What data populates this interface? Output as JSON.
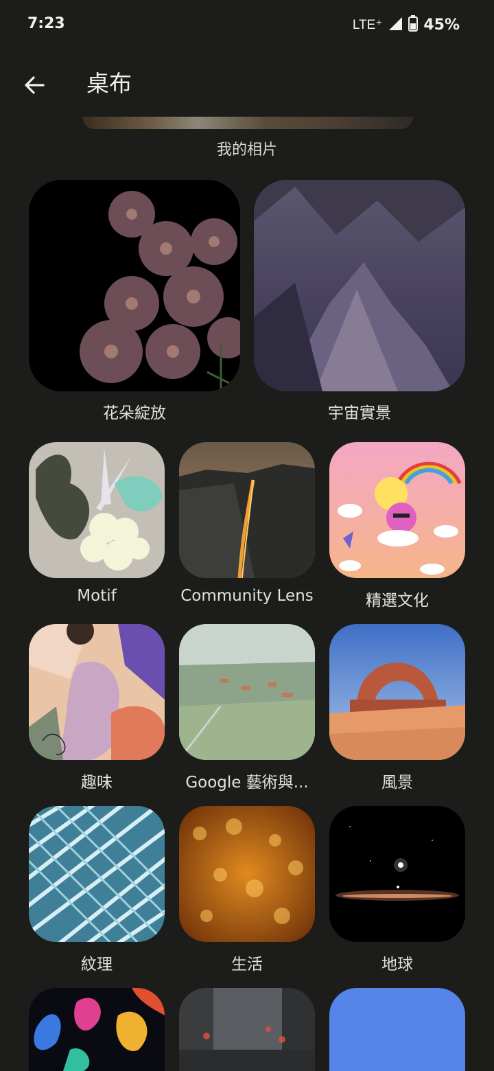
{
  "status": {
    "time": "7:23",
    "network": "LTE⁺",
    "battery": "45%"
  },
  "appbar": {
    "title": "桌布"
  },
  "my_photos": {
    "label": "我的相片"
  },
  "categories": [
    {
      "label": "花朵綻放"
    },
    {
      "label": "宇宙實景"
    },
    {
      "label": "Motif"
    },
    {
      "label": "Community Lens"
    },
    {
      "label": "精選文化"
    },
    {
      "label": "趣味"
    },
    {
      "label": "Google 藝術與..."
    },
    {
      "label": "風景"
    },
    {
      "label": "紋理"
    },
    {
      "label": "生活"
    },
    {
      "label": "地球"
    }
  ]
}
